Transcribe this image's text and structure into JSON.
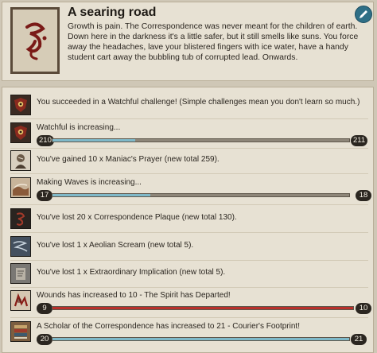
{
  "story": {
    "title": "A searing road",
    "body": "Growth is pain. The Correspondence was never meant for the children of earth. Down here in the darkness it's a little safer, but it still smells like suns. You force away the headaches, lave your blistered fingers with ice water, have a handy student cart away the bubbling tub of corrupted lead. Onwards.",
    "image_icon": "correspondence-sigil",
    "edit_icon": "pencil-icon"
  },
  "results": [
    {
      "text": "You succeeded in a Watchful challenge! (Simple challenges mean you don't learn so much.)",
      "icon": "watchful-eye-icon"
    },
    {
      "text": "Watchful is increasing...",
      "icon": "watchful-eye-icon",
      "bar": {
        "from": "210",
        "to": "211",
        "progress": 0.28,
        "color": "#7fb9c9"
      }
    },
    {
      "text": "You've gained 10 x Maniac's Prayer (new total 259).",
      "icon": "maniacs-prayer-icon"
    },
    {
      "text": "Making Waves is increasing...",
      "icon": "making-waves-icon",
      "bar": {
        "from": "17",
        "to": "18",
        "progress": 0.33,
        "color": "#7fb9c9"
      }
    },
    {
      "text": "You've lost 20 x Correspondence Plaque (new total 130).",
      "icon": "correspondence-plaque-icon"
    },
    {
      "text": "You've lost 1 x Aeolian Scream (new total 5).",
      "icon": "aeolian-scream-icon"
    },
    {
      "text": "You've lost 1 x Extraordinary Implication (new total 5).",
      "icon": "extraordinary-implication-icon"
    },
    {
      "text": "Wounds has increased to 10 - The Spirit has Departed!",
      "icon": "wounds-icon",
      "bar": {
        "from": "9",
        "to": "10",
        "progress": 1.0,
        "color": "#b9302b"
      }
    },
    {
      "text": "A Scholar of the Correspondence has increased to 21 - Courier's Footprint!",
      "icon": "scholar-icon",
      "bar": {
        "from": "20",
        "to": "21",
        "progress": 1.0,
        "color": "#7fb9c9"
      }
    }
  ]
}
